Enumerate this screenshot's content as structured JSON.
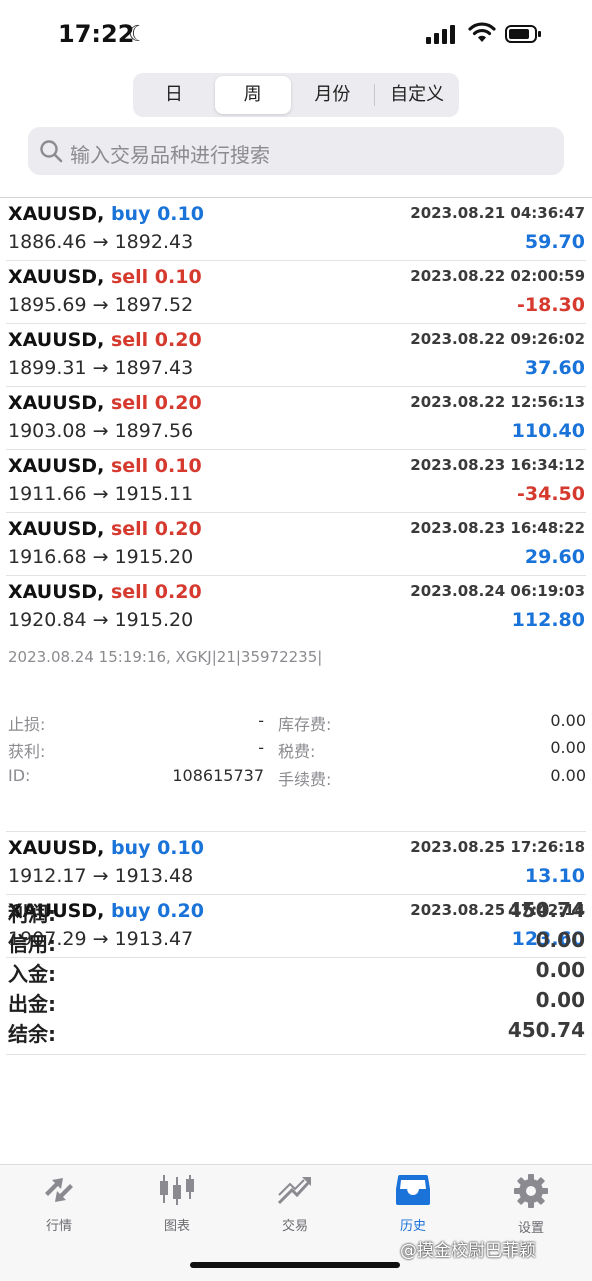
{
  "status_bar": {
    "time": "17:22",
    "moon": "☾"
  },
  "period_tabs": {
    "items": [
      "日",
      "周",
      "月份",
      "自定义"
    ],
    "selected": "周"
  },
  "search": {
    "placeholder": "输入交易品种进行搜索"
  },
  "deals": [
    {
      "symbol": "XAUUSD,",
      "side": "buy",
      "lots": "0.10",
      "date": "2023.08.21 04:36:47",
      "open": "1886.46",
      "close": "1892.43",
      "profit": "59.70"
    },
    {
      "symbol": "XAUUSD,",
      "side": "sell",
      "lots": "0.10",
      "date": "2023.08.22 02:00:59",
      "open": "1895.69",
      "close": "1897.52",
      "profit": "-18.30"
    },
    {
      "symbol": "XAUUSD,",
      "side": "sell",
      "lots": "0.20",
      "date": "2023.08.22 09:26:02",
      "open": "1899.31",
      "close": "1897.43",
      "profit": "37.60"
    },
    {
      "symbol": "XAUUSD,",
      "side": "sell",
      "lots": "0.20",
      "date": "2023.08.22 12:56:13",
      "open": "1903.08",
      "close": "1897.56",
      "profit": "110.40"
    },
    {
      "symbol": "XAUUSD,",
      "side": "sell",
      "lots": "0.10",
      "date": "2023.08.23 16:34:12",
      "open": "1911.66",
      "close": "1915.11",
      "profit": "-34.50"
    },
    {
      "symbol": "XAUUSD,",
      "side": "sell",
      "lots": "0.20",
      "date": "2023.08.23 16:48:22",
      "open": "1916.68",
      "close": "1915.20",
      "profit": "29.60"
    },
    {
      "symbol": "XAUUSD,",
      "side": "sell",
      "lots": "0.20",
      "date": "2023.08.24 06:19:03",
      "open": "1920.84",
      "close": "1915.20",
      "profit": "112.80"
    },
    {
      "symbol": "XAUUSD,",
      "side": "buy",
      "lots": "0.10",
      "date": "2023.08.25 17:26:18",
      "open": "1912.17",
      "close": "1913.48",
      "profit": "13.10"
    },
    {
      "symbol": "XAUUSD,",
      "side": "buy",
      "lots": "0.20",
      "date": "2023.08.25 17:42:14",
      "open": "1907.29",
      "close": "1913.47",
      "profit": "123.60"
    }
  ],
  "arrow": "→",
  "expanded_detail": {
    "comment": "2023.08.24 15:19:16, XGKJ|21|35972235|",
    "rows": [
      {
        "label1": "止损:",
        "value1": "-",
        "label2": "库存费:",
        "value2": "0.00"
      },
      {
        "label1": "获利:",
        "value1": "-",
        "label2": "税费:",
        "value2": "0.00"
      },
      {
        "label1": "ID:",
        "value1": "108615737",
        "label2": "手续费:",
        "value2": "0.00"
      }
    ]
  },
  "summary": [
    {
      "label": "利润:",
      "value": "450.74"
    },
    {
      "label": "信用:",
      "value": "0.00"
    },
    {
      "label": "入金:",
      "value": "0.00"
    },
    {
      "label": "出金:",
      "value": "0.00"
    },
    {
      "label": "结余:",
      "value": "450.74"
    }
  ],
  "tabbar": [
    {
      "label": "行情",
      "icon": "quotes-icon"
    },
    {
      "label": "图表",
      "icon": "chart-icon"
    },
    {
      "label": "交易",
      "icon": "trade-icon"
    },
    {
      "label": "历史",
      "icon": "history-icon",
      "active": true
    },
    {
      "label": "设置",
      "icon": "settings-icon"
    }
  ],
  "watermark": "@摸金校尉巴菲颖",
  "colors": {
    "buy": "#1a73d9",
    "sell": "#d63a2f",
    "active_tab": "#1a73d9"
  }
}
